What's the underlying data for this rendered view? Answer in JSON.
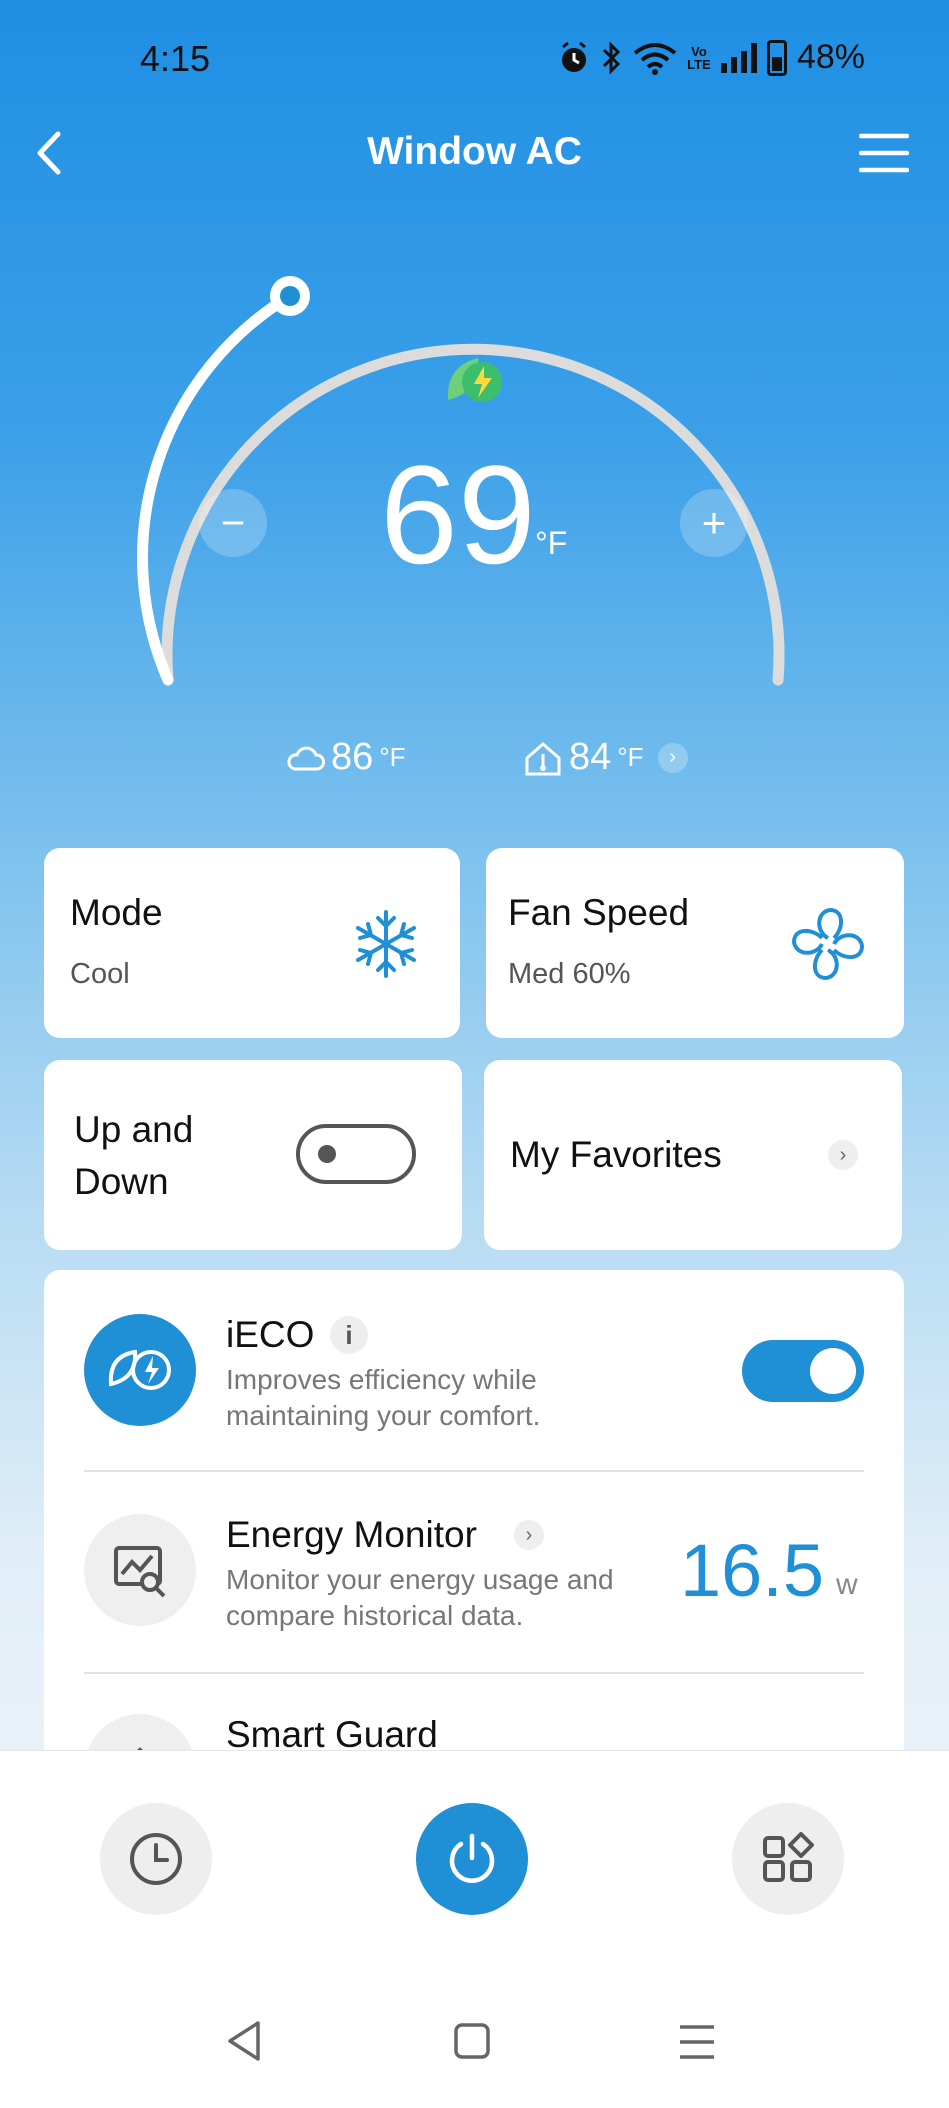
{
  "status": {
    "time": "4:15",
    "battery": "48%",
    "icons": [
      "alarm-icon",
      "bluetooth-icon",
      "wifi-icon",
      "volte-icon",
      "signal-icon",
      "battery-icon"
    ],
    "volte": "Vo LTE"
  },
  "header": {
    "title": "Window AC",
    "back_icon": "chevron-left-icon",
    "menu_icon": "hamburger-menu-icon"
  },
  "thermostat": {
    "setpoint": "69",
    "unit": "°F",
    "minus_label": "−",
    "plus_label": "+",
    "eco_icon": "eco-leaf-bolt-icon"
  },
  "conditions": {
    "outdoor_temp": "86",
    "outdoor_unit": "°F",
    "indoor_temp": "84",
    "indoor_unit": "°F"
  },
  "cards": {
    "mode": {
      "title": "Mode",
      "value": "Cool",
      "icon": "snowflake-icon"
    },
    "fan": {
      "title": "Fan Speed",
      "value": "Med 60%",
      "icon": "fan-icon"
    },
    "updown": {
      "title_line1": "Up and",
      "title_line2": "Down",
      "enabled": false
    },
    "favorites": {
      "title": "My Favorites"
    }
  },
  "features": {
    "ieco": {
      "title": "iECO",
      "info": "i",
      "desc_line1": "Improves efficiency while",
      "desc_line2": "maintaining your comfort.",
      "enabled": true
    },
    "energy": {
      "title": "Energy Monitor",
      "desc_line1": "Monitor your energy usage and",
      "desc_line2": "compare historical data.",
      "value": "16.5",
      "unit": "w"
    },
    "guard": {
      "title": "Smart Guard"
    }
  },
  "colors": {
    "accent": "#1f8fd6",
    "eco_green": "#5cc35c"
  },
  "bottom_nav": {
    "timer_icon": "clock-icon",
    "power_icon": "power-icon",
    "more_icon": "grid-icon"
  },
  "system_nav": {
    "back_icon": "triangle-back-icon",
    "home_icon": "square-home-icon",
    "recents_icon": "lines-recents-icon"
  }
}
